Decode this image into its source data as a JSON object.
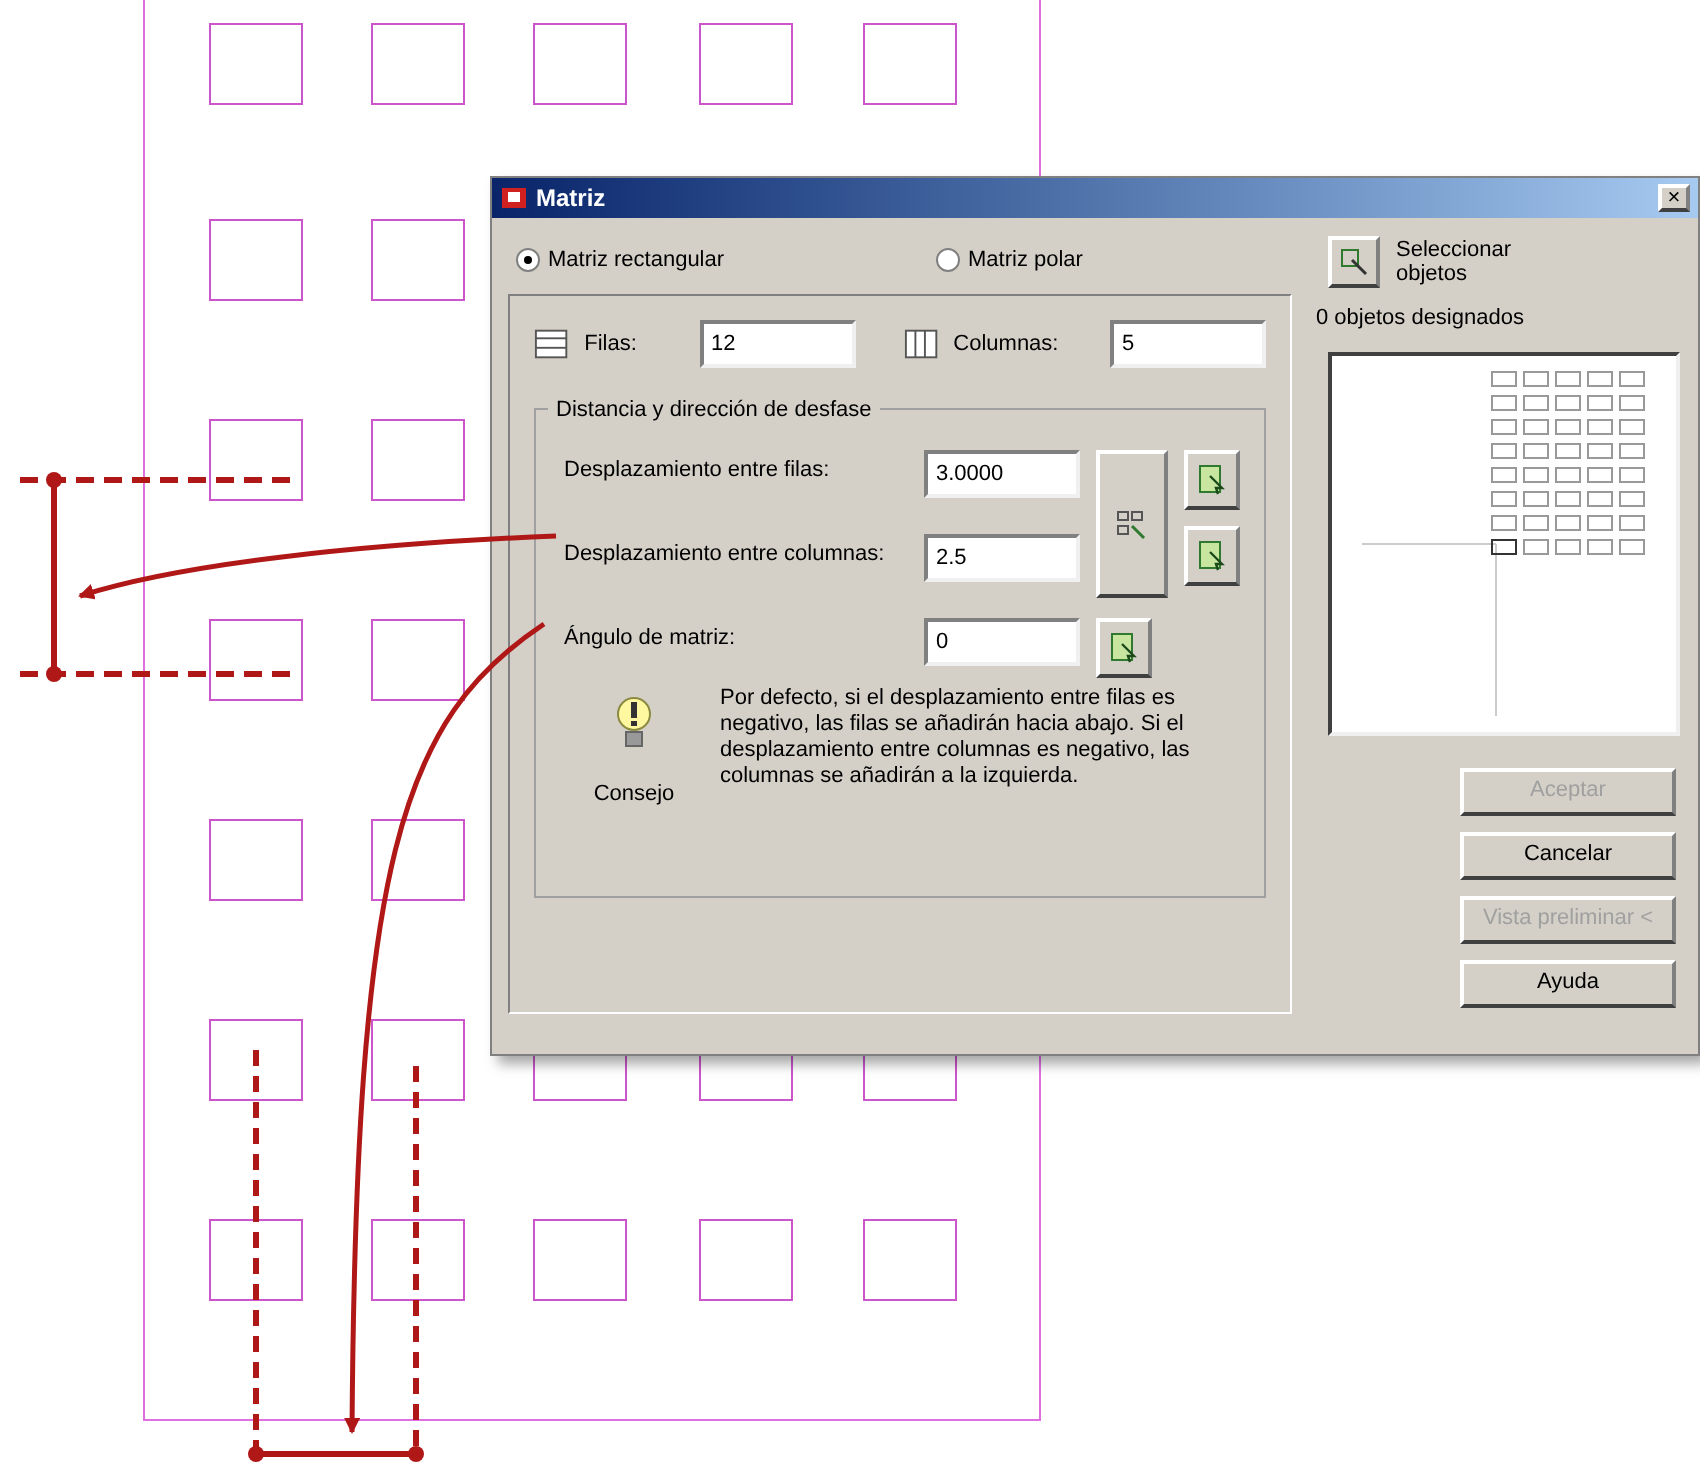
{
  "window": {
    "title": "Matriz",
    "close": "×"
  },
  "array_types": [
    {
      "label": "Matriz rectangular",
      "selected": true
    },
    {
      "label": "Matriz polar",
      "selected": false
    }
  ],
  "select_objects": {
    "label": "Seleccionar objetos",
    "count": "0 objetos designados"
  },
  "rows": {
    "label": "Filas:",
    "value": "12"
  },
  "columns": {
    "label": "Columnas:",
    "value": "5"
  },
  "offset_group": {
    "title": "Distancia y dirección de desfase",
    "fields": [
      {
        "label": "Desplazamiento entre filas:",
        "value": "3.0000"
      },
      {
        "label": "Desplazamiento entre columnas:",
        "value": "2.5"
      },
      {
        "label": "Ángulo de matriz:",
        "value": "0"
      }
    ]
  },
  "tip": {
    "caption": "Consejo",
    "text": "Por defecto, si el desplazamiento entre filas es negativo, las filas se añadirán hacia abajo. Si el desplazamiento entre columnas es negativo, las columnas se añadirán a la izquierda."
  },
  "buttons": [
    {
      "label": "Aceptar",
      "disabled": true
    },
    {
      "label": "Cancelar",
      "disabled": false
    },
    {
      "label": "Vista preliminar <",
      "disabled": true
    },
    {
      "label": "Ayuda",
      "disabled": false
    }
  ]
}
